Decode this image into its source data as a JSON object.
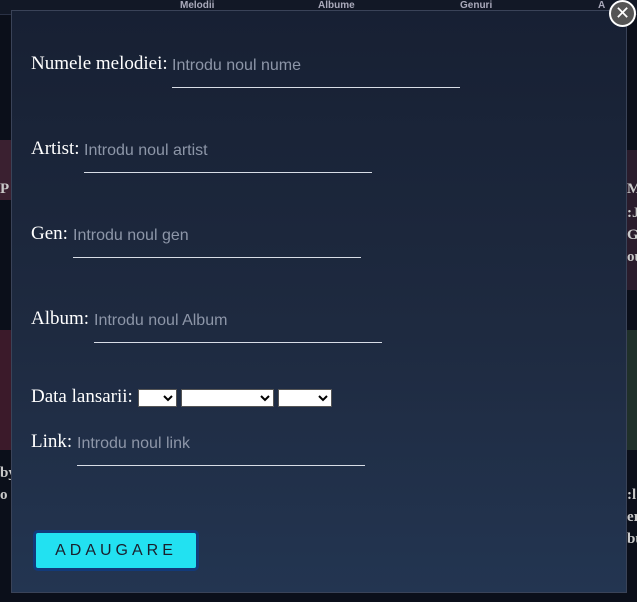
{
  "background_nav": [
    "Melodii",
    "Albume",
    "Genuri",
    "A"
  ],
  "background_fragments": [
    "P",
    "M",
    ":J",
    "G",
    "ou",
    "by",
    "o",
    ":l",
    "er",
    "bu"
  ],
  "form": {
    "name_label": "Numele melodiei:",
    "name_placeholder": "Introdu noul nume",
    "artist_label": "Artist:",
    "artist_placeholder": "Introdu noul artist",
    "genre_label": "Gen:",
    "genre_placeholder": "Introdu noul gen",
    "album_label": "Album:",
    "album_placeholder": "Introdu noul Album",
    "date_label": "Data lansarii:",
    "link_label": "Link:",
    "link_placeholder": "Introdu noul link",
    "submit_label": "ADAUGARE"
  },
  "close_symbol": "✕"
}
